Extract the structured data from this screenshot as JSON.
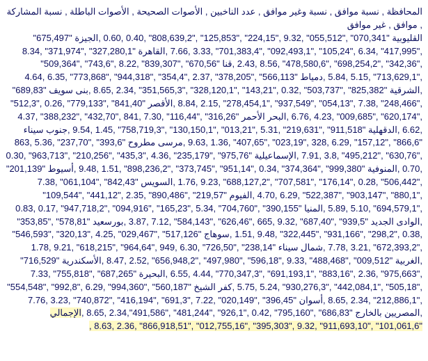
{
  "header": "المحافظة , نسبة  موافق , نسبة  وغير  موافق , عدد  الناخبين , الأصوات  الصحيحة , الأصوات  الباطلة , نسبة  المشاركة , موافق , غير  موافق",
  "rows": [
    {
      "name": "القليوبية",
      "data": "\"070,341\" ,\"055,512\" ,9.32 ,\"224,15\" ,\"125,853\" ,\"808,639,2\" ,0.40 ,0.60 ,"
    },
    {
      "name": "الجيزة",
      "data": "\"675,497\" ,\"417,995\" ,6.34 ,\"105,24\" ,\"092,493,1\" ,\"701,383,4\" ,3.33 ,7.66 ,"
    },
    {
      "name": "القاهرة",
      "data": "\"327,280,1\" ,\"371,974\" ,8.34 ,\"342,36\" ,\"698,254,2\" ,\"478,580,6\" ,8.56 ,2.43 ,"
    },
    {
      "name": "قنا",
      "data": "\"670,56\" ,\"839,307\" ,8.22 ,\"743,6\" ,\"509,364\" ,\"713,629,1\" ,5.15 ,5.84 ,"
    },
    {
      "name": "دمياط",
      "data": "\"566,113\" ,\"378,205\" ,2.37 ,\"354,4\" ,\"944,318\" ,\"773,868\" ,6.35 ,4.64 ,"
    },
    {
      "name": "الشرقية",
      "data": "\"825,382\" ,\"503,737\" ,0.32 ,\"143,21\" ,\"328,120,1\" ,\"351,565,3\" ,2.34 ,8.65 ,"
    },
    {
      "name": "بنى  سويف",
      "data": "\"689,83\" ,\"248,466\" ,7.38 ,\"054,13\" ,\"937,549\" ,\"278,454,1\" ,2.15 ,8.84 ,"
    },
    {
      "name": "الأقصر",
      "data": "\"841,40\" ,\"779,133\" ,0.26 ,\"512,3\" ,\"620,174\" ,\"009,685\" ,4.23 ,6.76 ,"
    },
    {
      "name": "البحر الأحمر",
      "data": "\"316,26\" ,\"116,44\" ,7.30 ,841 ,\"432,70\" ,\"388,232\" ,4.37 ,6.62 ,"
    },
    {
      "name": "الدقهلية",
      "data": "\"911,518\" ,\"219,631\" ,5.31 ,\"013,21\" ,\"130,150,1\" ,\"758,719,3\" ,1.45 ,9.54 ,"
    },
    {
      "name": "جنوب  سيناء",
      "data": "\"866,6\" ,\"157,12\" ,6.29 ,328 ,\"023,19\" ,\"407,65\" ,1.36 ,9.63 ,"
    },
    {
      "name": "مرسى  مطروح",
      "data": "\"393,6\" ,\"237,70\" ,5.36 ,863 ,\"630,76\" ,\"495,212\" ,3.8 ,7.91 ,"
    },
    {
      "name": "الإسماعيلية",
      "data": "\"975,76\" ,\"235,179\" ,4.36 ,\"435,3\" ,\"210,256\" ,\"963,713\" ,0.30 ,0.70 ,"
    },
    {
      "name": "المنوفية",
      "data": "\"999,380\" ,\"374,364\" ,0.34 ,\"951,14\" ,\"373,745\" ,\"898,236,2\" ,1.51 ,9.48 ,"
    },
    {
      "name": "أسيوط",
      "data": "\"201,139\" ,\"506,442\" ,0.28 ,\"176,14\" ,\"707,581\" ,\"688,127,2\" ,9.23 ,1.76 ,"
    },
    {
      "name": "السويس",
      "data": "\"842,43\" ,\"061,104\" ,7.38 ,\"880,1\" ,\"903,147\" ,\"522,387\" ,6.29 ,4.70 ,"
    },
    {
      "name": "الفيوم",
      "data": "\"219,57\" ,\"890,486\" ,2.35 ,\"441,12\" ,\"109,544\" ,\"694,579,1\" ,5.10 ,5.89 ,"
    },
    {
      "name": "المنيا",
      "data": "\"390,155\" ,\"704,760\" ,5.34 ,\"165,23\" ,\"094,916\" ,\"947,718,2\" ,0.17 ,0.83 ,"
    },
    {
      "name": "الوادى  الجديد",
      "data": "\"939,5\" ,\"687,40\" ,9.32 ,665 ,\"626,46\" ,\"584,143\" ,7.12 ,3.87 ,"
    },
    {
      "name": "بورسعيد",
      "data": "\"578,81\" ,\"353,85\" ,0.38 ,\"298,2\" ,\"931,166\" ,\"322,445\" ,9.48 ,1.51 ,"
    },
    {
      "name": "سوهاج",
      "data": "\"517,126\" ,\"029,467\" ,4.25 ,\"320,13\" ,\"546,593\" ,\"672,393,2\" ,3.21 ,7.78 ,"
    },
    {
      "name": "شمال  سيناء",
      "data": "\"238,14\" ,\"726,50\" ,6.30 ,949 ,\"964,64\" ,\"618,215\" ,9.21 ,1.78 ,"
    },
    {
      "name": "الغربية",
      "data": "\"009,512\" ,\"488,468\" ,9.33 ,\"596,18\" ,\"497,980\" ,\"656,948,2\" ,2.52 ,8.47 ,"
    },
    {
      "name": "الأسكندرية",
      "data": "\"716,529\" ,\"975,663\" ,2.36 ,\"883,16\" ,\"691,193,1\" ,\"770,347,3\" ,4.44 ,6.55 ,"
    },
    {
      "name": "البحيرة",
      "data": "\"687,265\" ,\"755,818\" ,7.33 ,\"505,18\" ,\"442,084,1\" ,\"930,276,3\" ,5.24 ,5.75 ,"
    },
    {
      "name": "كفر  الشيخ",
      "data": "\"560,187\" ,\"994,360\" ,6.29 ,\"992,8\" ,\"554,548\" ,\"212,886,1\" ,2.34 ,8.65 ,"
    },
    {
      "name": "أسوان",
      "data": "\"396,45\" ,\"020,149\" ,7.22 ,\"691,3\" ,\"416,194\" ,\"740,872\" ,3.23 ,7.76 ,"
    },
    {
      "name": "المصريين بالخارج",
      "data": "\"686,83\" ,\"795,160\" ,0.42 ,\"926,1\" ,\"481,244\" ,\"491,586\",2.34 ,8.65 ,"
    },
    {
      "name": "الإجمالي",
      "data": "\"101,061,6\" ,\"911,693,10\" ,9.32 ,\"395,303\" ,\"012,755,16\" ,\"866,918,51\" ,2.36 ,8.63 ,"
    }
  ]
}
